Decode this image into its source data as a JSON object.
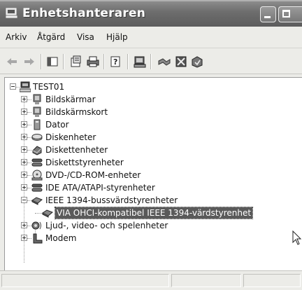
{
  "window": {
    "title": "Enhetshanteraren"
  },
  "menu": {
    "items": [
      "Arkiv",
      "Åtgärd",
      "Visa",
      "Hjälp"
    ]
  },
  "toolbar": {
    "icons": [
      "back-arrow-icon",
      "forward-arrow-icon",
      "console-tree-icon",
      "properties-icon",
      "print-icon",
      "help-icon",
      "scan-hardware-icon",
      "uninstall-icon",
      "disable-icon",
      "update-driver-icon"
    ]
  },
  "tree": {
    "root": "TEST01",
    "items": [
      {
        "label": "Bildskärmar",
        "icon": "monitor-icon",
        "expanded": false
      },
      {
        "label": "Bildskärmskort",
        "icon": "display-adapter-icon",
        "expanded": false
      },
      {
        "label": "Dator",
        "icon": "computer-icon",
        "expanded": false
      },
      {
        "label": "Diskenheter",
        "icon": "disk-drive-icon",
        "expanded": false
      },
      {
        "label": "Diskettenheter",
        "icon": "floppy-drive-icon",
        "expanded": false
      },
      {
        "label": "Diskettstyrenheter",
        "icon": "floppy-controller-icon",
        "expanded": false
      },
      {
        "label": "DVD-/CD-ROM-enheter",
        "icon": "cdrom-icon",
        "expanded": false
      },
      {
        "label": "IDE ATA/ATAPI-styrenheter",
        "icon": "ide-controller-icon",
        "expanded": false
      },
      {
        "label": "IEEE 1394-bussvärdstyrenheter",
        "icon": "ieee1394-icon",
        "expanded": true
      },
      {
        "label": "VIA OHCI-kompatibel IEEE 1394-värdstyrenhet",
        "icon": "ieee1394-device-icon",
        "child": true,
        "selected": true
      },
      {
        "label": "Ljud-, video- och spelenheter",
        "icon": "sound-icon",
        "expanded": false
      },
      {
        "label": "Modem",
        "icon": "modem-icon",
        "expanded": false
      }
    ]
  },
  "colors": {
    "selection": "#5a5a5a",
    "titlebar": "#6e6e6e"
  }
}
